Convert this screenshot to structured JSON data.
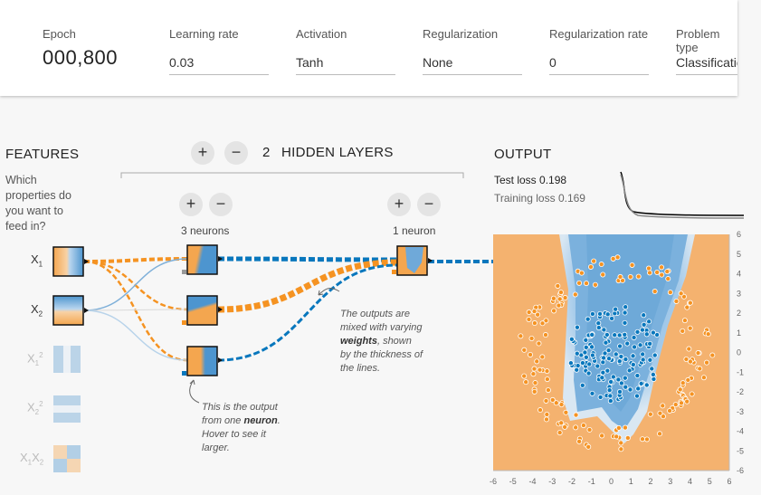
{
  "controls": {
    "epoch": {
      "label": "Epoch",
      "value": "000,800"
    },
    "learning_rate": {
      "label": "Learning rate",
      "value": "0.03"
    },
    "activation": {
      "label": "Activation",
      "value": "Tanh"
    },
    "regularization": {
      "label": "Regularization",
      "value": "None"
    },
    "regularization_rate": {
      "label": "Regularization rate",
      "value": "0"
    },
    "problem_type": {
      "label": "Problem type",
      "value": "Classification"
    }
  },
  "features": {
    "title": "FEATURES",
    "question": [
      "Which",
      "properties do",
      "you want to",
      "feed in?"
    ],
    "items": [
      {
        "base": "X",
        "sub": "1",
        "sup": "",
        "active": true
      },
      {
        "base": "X",
        "sub": "2",
        "sup": "",
        "active": true
      },
      {
        "base": "X",
        "sub": "1",
        "sup": "2",
        "active": false
      },
      {
        "base": "X",
        "sub": "2",
        "sup": "2",
        "active": false
      },
      {
        "base": "X",
        "sub": "1",
        "sup": "",
        "base2": "X",
        "sub2": "2",
        "active": false
      }
    ]
  },
  "hidden": {
    "plus": "+",
    "minus": "−",
    "count": "2",
    "title": "HIDDEN LAYERS",
    "layers": [
      {
        "neurons_label": "3 neurons"
      },
      {
        "neurons_label": "1 neuron"
      }
    ]
  },
  "notes": {
    "weights_note": [
      "The outputs are",
      "mixed with varying",
      "",
      "by the thickness of",
      "the lines."
    ],
    "weights_bold": "weights",
    "weights_after_bold": ", shown",
    "neuron_note": [
      "This is the output",
      "from one ",
      ".",
      "Hover to see it",
      "larger."
    ],
    "neuron_bold": "neuron"
  },
  "output": {
    "title": "OUTPUT",
    "test_loss_label": "Test loss",
    "test_loss": "0.198",
    "training_loss_label": "Training loss",
    "training_loss": "0.169",
    "axis_ticks": [
      "-6",
      "-5",
      "-4",
      "-3",
      "-2",
      "-1",
      "0",
      "1",
      "2",
      "3",
      "4",
      "5",
      "6"
    ]
  },
  "colors": {
    "orange": "#f59322",
    "blue": "#0877bd",
    "orange_bg": "#f4b26f",
    "blue_bg": "#6ea9d8"
  }
}
